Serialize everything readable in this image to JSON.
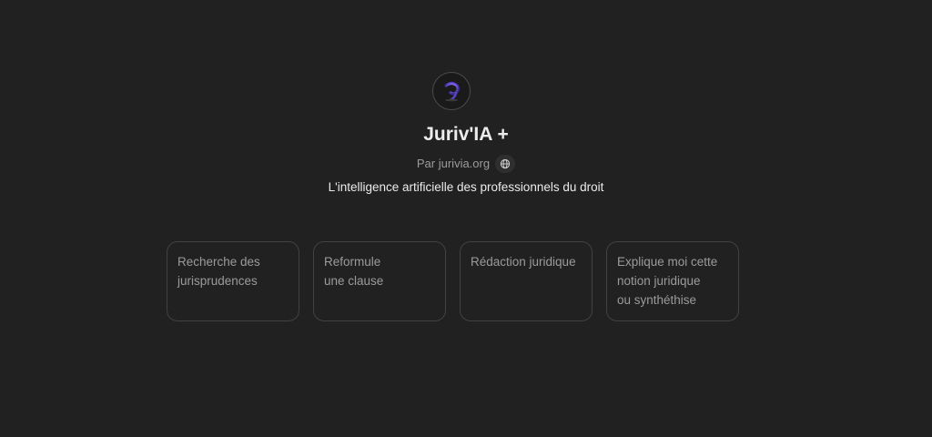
{
  "gpt": {
    "avatar_icon": "jurivia-logo-icon",
    "title": "Juriv'IA +",
    "byline": "Par jurivia.org",
    "byline_icon": "globe-icon",
    "description": "L'intelligence artificielle des professionnels du droit"
  },
  "conversation_starters": [
    {
      "label": "Recherche des\njurisprudences"
    },
    {
      "label": "Reformule\nune clause"
    },
    {
      "label": "Rédaction juridique"
    },
    {
      "label": "Explique moi cette\nnotion juridique\nou synthéthise"
    }
  ],
  "colors": {
    "background": "#212121",
    "card_border": "#424242",
    "title_text": "#ececec",
    "muted_text": "#9b9b9b",
    "logo_accent": "#7b5cf0"
  }
}
